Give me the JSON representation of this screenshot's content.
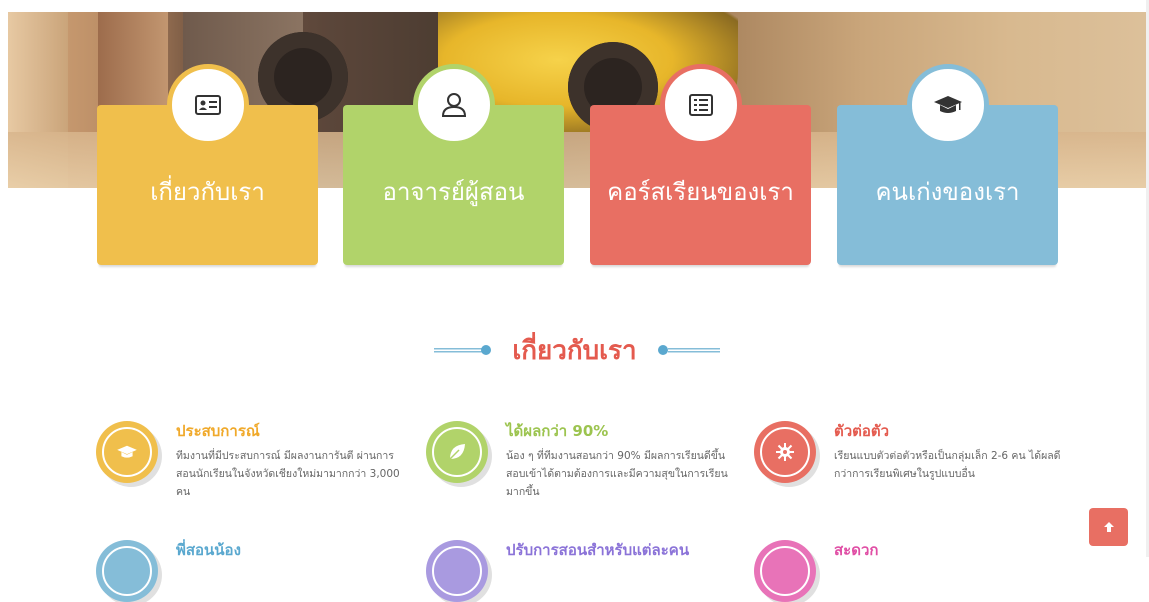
{
  "cards": [
    {
      "title": "เกี่ยวกับเรา",
      "icon": "id-card-icon"
    },
    {
      "title": "อาจารย์ผู้สอน",
      "icon": "user-icon"
    },
    {
      "title": "คอร์สเรียนของเรา",
      "icon": "list-icon"
    },
    {
      "title": "คนเก่งของเรา",
      "icon": "graduation-cap-icon"
    }
  ],
  "section": {
    "title": "เกี่ยวกับเรา"
  },
  "features": [
    {
      "title": "ประสบการณ์",
      "text": "ทีมงานที่มีประสบการณ์ มีผลงานการันตี ผ่านการสอนนักเรียนในจังหวัดเชียงใหม่มามากกว่า 3,000 คน",
      "icon": "graduation-cap-icon",
      "color": "#f0bf4c"
    },
    {
      "title": "ได้ผลกว่า 90%",
      "text": "น้อง ๆ ที่ทีมงานสอนกว่า 90% มีผลการเรียนดีขึ้น สอบเข้าได้ตามต้องการและมีความสุขในการเรียนมากขึ้น",
      "icon": "leaf-icon",
      "color": "#b1d36a"
    },
    {
      "title": "ตัวต่อตัว",
      "text": "เรียนแบบตัวต่อตัวหรือเป็นกลุ่มเล็ก 2-6 คน ได้ผลดีกว่าการเรียนพิเศษในรูปแบบอื่น",
      "icon": "gear-icon",
      "color": "#e86f63"
    },
    {
      "title": "พี่สอนน้อง",
      "text": "",
      "icon": "circle-icon",
      "color": "#85bdd8"
    },
    {
      "title": "ปรับการสอนสำหรับแต่ละคน",
      "text": "",
      "icon": "circle-icon",
      "color": "#a99ae0"
    },
    {
      "title": "สะดวก",
      "text": "",
      "icon": "circle-icon",
      "color": "#e873b8"
    }
  ],
  "scroll_top": {
    "icon": "arrow-up-icon"
  }
}
